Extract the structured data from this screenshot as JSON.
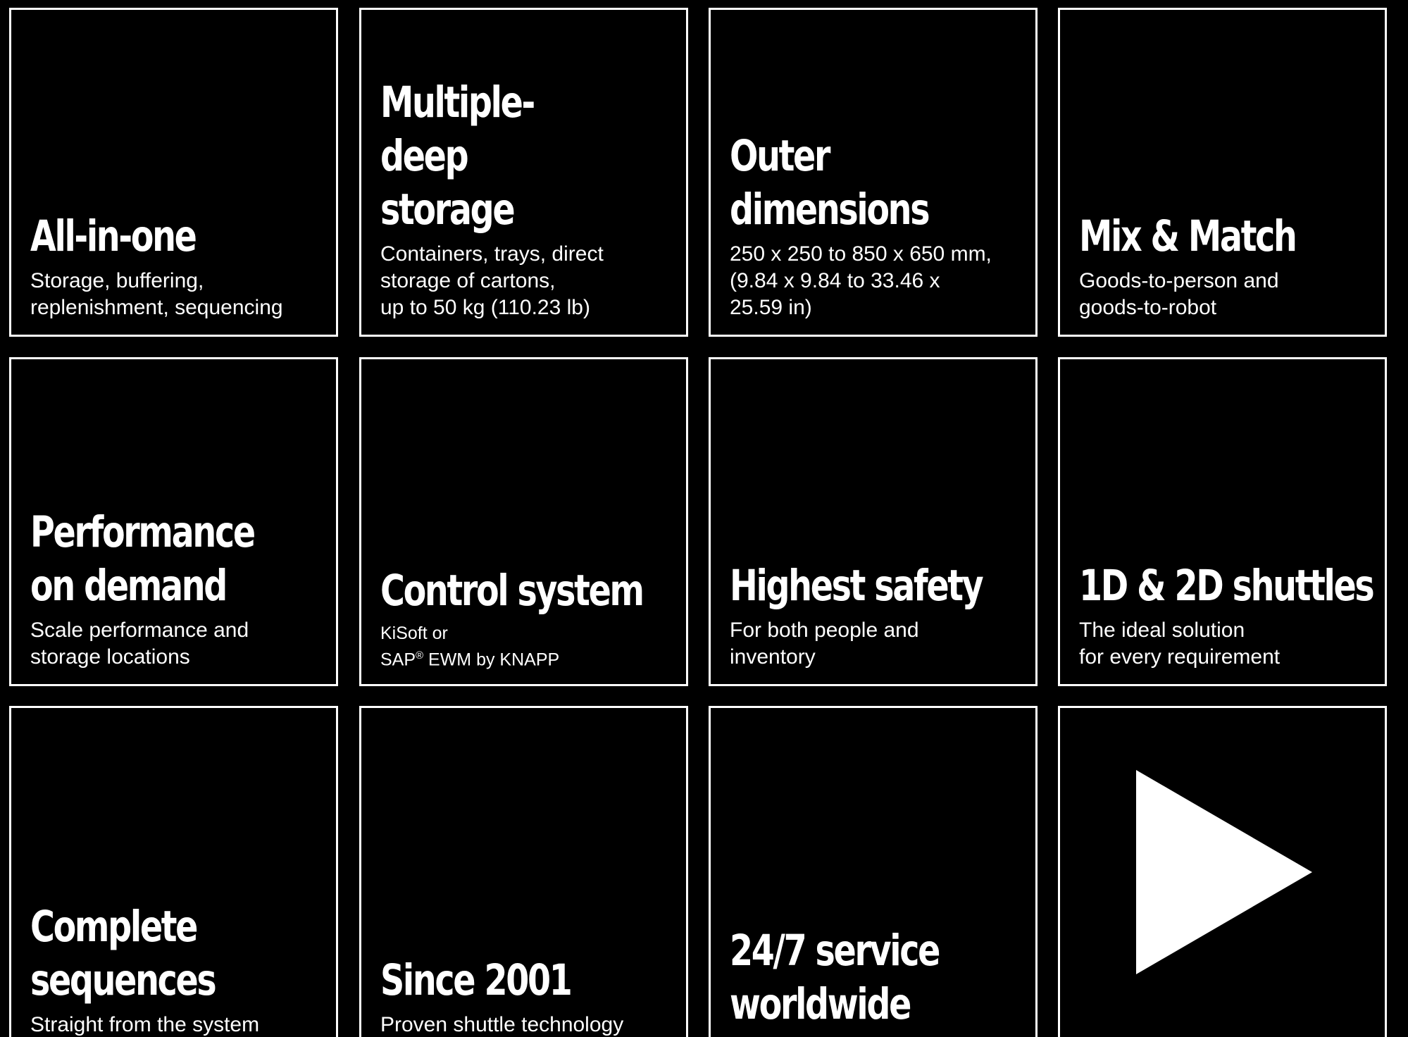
{
  "tiles": [
    {
      "title": "All-in-one",
      "subtitle": "Storage, buffering,\nreplenishment, sequencing"
    },
    {
      "title": "Multiple-deep\nstorage",
      "subtitle": "Containers, trays, direct\nstorage of cartons,\nup to 50 kg (110.23 lb)"
    },
    {
      "title": "Outer\ndimensions",
      "subtitle": "250 x 250 to 850 x 650 mm,\n(9.84 x 9.84 to 33.46 x\n25.59 in)"
    },
    {
      "title": "Mix & Match",
      "subtitle": "Goods-to-person and\ngoods-to-robot"
    },
    {
      "title": "Performance\non demand",
      "subtitle": "Scale performance and\nstorage locations"
    },
    {
      "title": "Control system",
      "subtitle_line1": "KiSoft or",
      "subtitle_line2_prefix": "SAP",
      "subtitle_line2_mark": "®",
      "subtitle_line2_suffix": " EWM by KNAPP"
    },
    {
      "title": "Highest safety",
      "subtitle": "For both people and\ninventory"
    },
    {
      "title": "1D & 2D shuttles",
      "subtitle": "The ideal solution\nfor every requirement"
    },
    {
      "title": "Complete\nsequences",
      "subtitle": "Straight from the system"
    },
    {
      "title": "Since 2001",
      "subtitle": "Proven shuttle technology"
    },
    {
      "title": "24/7 service\nworldwide",
      "subtitle": ""
    }
  ],
  "video": {
    "icon": "play-icon"
  },
  "colors": {
    "background": "#000000",
    "foreground": "#ffffff"
  }
}
